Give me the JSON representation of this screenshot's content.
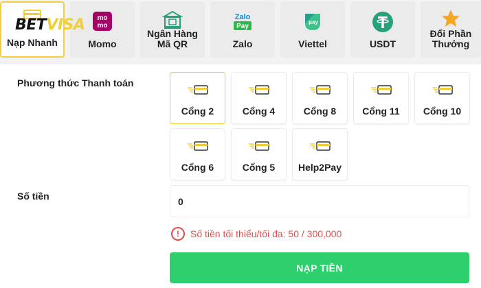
{
  "brand": {
    "name_part1": "BET",
    "name_part2": "VISA"
  },
  "tabs": [
    {
      "label": "Nạp Nhanh",
      "icon": "card-icon",
      "active": true
    },
    {
      "label": "Momo",
      "icon": "momo-icon",
      "icon_text": "mo mo"
    },
    {
      "label": "Ngân Hàng\nMã QR",
      "icon": "bank-qr-icon"
    },
    {
      "label": "Zalo",
      "icon": "zalopay-icon",
      "icon_text_top": "Zalo",
      "icon_text_bottom": "Pay"
    },
    {
      "label": "Viettel",
      "icon": "viettel-pay-icon",
      "icon_text": "pay"
    },
    {
      "label": "USDT",
      "icon": "tether-icon",
      "icon_text": "₮"
    },
    {
      "label": "Đổi Phần\nThưởng",
      "icon": "star-icon"
    }
  ],
  "payment_method": {
    "label": "Phương thức Thanh toán",
    "gates": [
      {
        "label": "Cổng 2",
        "active": true
      },
      {
        "label": "Cổng 4"
      },
      {
        "label": "Cổng 8"
      },
      {
        "label": "Cổng 11"
      },
      {
        "label": "Cổng 10"
      },
      {
        "label": "Cổng 6"
      },
      {
        "label": "Cổng 5"
      },
      {
        "label": "Help2Pay"
      }
    ]
  },
  "amount": {
    "label": "Số tiền",
    "value": "0",
    "warning": "Số tiền tối thiểu/tối đa: 50 / 300,000",
    "warning_icon": "!"
  },
  "submit_label": "NẠP TIỀN",
  "colors": {
    "accent": "#f2cf3a",
    "green": "#2ed06e",
    "error": "#e24b4b",
    "momo": "#a50064",
    "zalo": "#0a8fd6",
    "teal": "#26a17b"
  }
}
